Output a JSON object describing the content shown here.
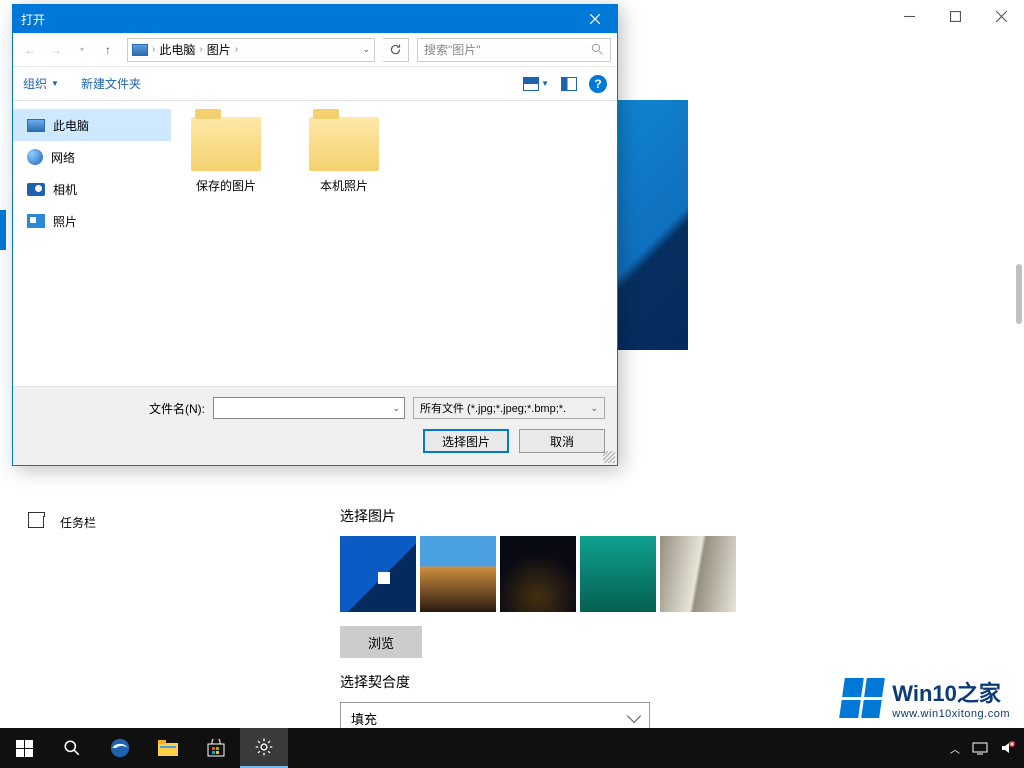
{
  "bgWindow": {
    "sidebar": {
      "taskbar": "任务栏"
    },
    "sections": {
      "choosePicture": "选择图片",
      "browse": "浏览",
      "chooseFit": "选择契合度",
      "fitValue": "填充"
    }
  },
  "dialog": {
    "title": "打开",
    "breadcrumb": {
      "root": "此电脑",
      "folder": "图片"
    },
    "search": {
      "placeholder": "搜索\"图片\""
    },
    "toolbar": {
      "organize": "组织",
      "newFolder": "新建文件夹",
      "help": "?"
    },
    "tree": [
      {
        "label": "此电脑",
        "selected": true,
        "icon": "pc"
      },
      {
        "label": "网络",
        "selected": false,
        "icon": "net"
      },
      {
        "label": "相机",
        "selected": false,
        "icon": "cam"
      },
      {
        "label": "照片",
        "selected": false,
        "icon": "photo"
      }
    ],
    "folders": [
      {
        "label": "保存的图片"
      },
      {
        "label": "本机照片"
      }
    ],
    "fileNameLabel": "文件名(N):",
    "fileNameValue": "",
    "filter": "所有文件 (*.jpg;*.jpeg;*.bmp;*.",
    "buttons": {
      "open": "选择图片",
      "cancel": "取消"
    }
  },
  "watermark": {
    "brand": "Win10",
    "suffix": "之家",
    "url": "www.win10xitong.com"
  }
}
